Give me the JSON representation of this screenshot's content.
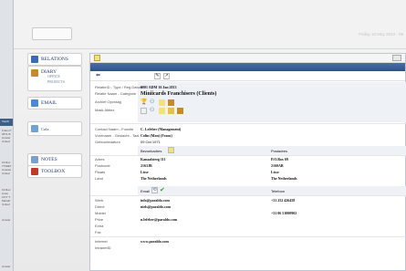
{
  "header": {
    "date": "Friday 10 May 2013 - 09"
  },
  "nav": {
    "relations": "RELATIONS",
    "diary": "DIARY",
    "office": "OFFICE",
    "projects": "PROJECTS",
    "email": "EMAIL",
    "cola": "Cola",
    "notes": "NOTES",
    "toolbox": "TOOLBOX"
  },
  "record": {
    "relatieid_label": "RelatieID - Type / Reg.Datum",
    "relatieid_value": "0001  ADM  16 Jan 2013",
    "name_label": "Relatie Naam - Categorie",
    "name_value": "Miniicards Franchisers (Clients)",
    "archief_label": "Archief Opvraag",
    "mask_label": "Mask Aktiez",
    "contact_label": "Contact Naam - Functie",
    "contact_value": "C. Lefeber (Management)",
    "voornaam_label": "Voornaam - Geslacht - Taal",
    "voornaam_value": "Colin (Man) (Frans)",
    "geboorte_label": "Geboortedatum",
    "geboorte_value": "09 Oct 1971"
  },
  "address": {
    "col1_header": "Bezoekadres",
    "col2_header": "Postadres",
    "rows": [
      {
        "label": "Adres",
        "v1": "Kanaalsteeg 111",
        "v2": "P.O.Box 69"
      },
      {
        "label": "Postcode",
        "v1": "2163JB",
        "v2": "2160AB"
      },
      {
        "label": "Plaats",
        "v1": "Lisse",
        "v2": "Lisse"
      },
      {
        "label": "Land",
        "v1": "The Netherlands",
        "v2": "The Netherlands"
      }
    ]
  },
  "contact": {
    "email_header": "Email",
    "tel_header": "Telefoon",
    "rows": [
      {
        "label": "Werk",
        "v1": "info@paraldo.com",
        "v2": "+31 252 426458"
      },
      {
        "label": "Direct",
        "v1": "niels@paraldo.com",
        "v2": ""
      },
      {
        "label": "Mobiel",
        "v1": "",
        "v2": "+31 06 51000902"
      },
      {
        "label": "Prive",
        "v1": "n.lefeber@paraldo.com",
        "v2": ""
      },
      {
        "label": "Extra",
        "v1": "",
        "v2": ""
      },
      {
        "label": "Fax",
        "v1": "",
        "v2": ""
      }
    ]
  },
  "web": {
    "internet_label": "Internet",
    "internet_value": "www.paraldo.com",
    "intranet_label": "IntranetID"
  },
  "background": {
    "texts": [
      "Voorb",
      "Frans P",
      "0571 B",
      "Amster",
      "United",
      "19 Rec",
      "7730ET",
      "Ameste",
      "United",
      "19 Rec",
      "Lisse",
      "1677 T",
      "Marath",
      "United",
      "Amster",
      "Amster"
    ]
  }
}
